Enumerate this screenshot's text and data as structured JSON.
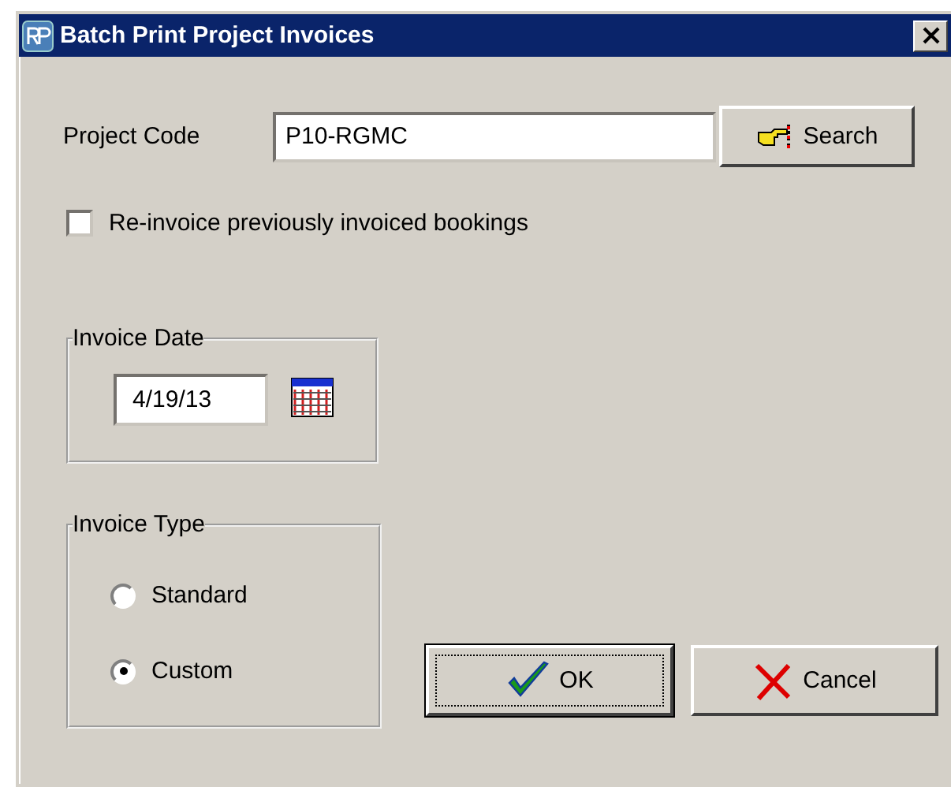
{
  "window": {
    "title": "Batch Print Project Invoices"
  },
  "project_code": {
    "label": "Project Code",
    "value": "P10-RGMC"
  },
  "search_button": {
    "label": "Search"
  },
  "reinvoice": {
    "label": "Re-invoice previously invoiced bookings",
    "checked": false
  },
  "invoice_date": {
    "title": "Invoice Date",
    "value": "4/19/13"
  },
  "invoice_type": {
    "title": "Invoice Type",
    "options": [
      {
        "label": "Standard",
        "selected": false
      },
      {
        "label": "Custom",
        "selected": true
      }
    ]
  },
  "buttons": [
    {
      "label": "OK",
      "kind": "ok",
      "focused": true
    },
    {
      "label": "Cancel",
      "kind": "cancel",
      "focused": false
    }
  ]
}
